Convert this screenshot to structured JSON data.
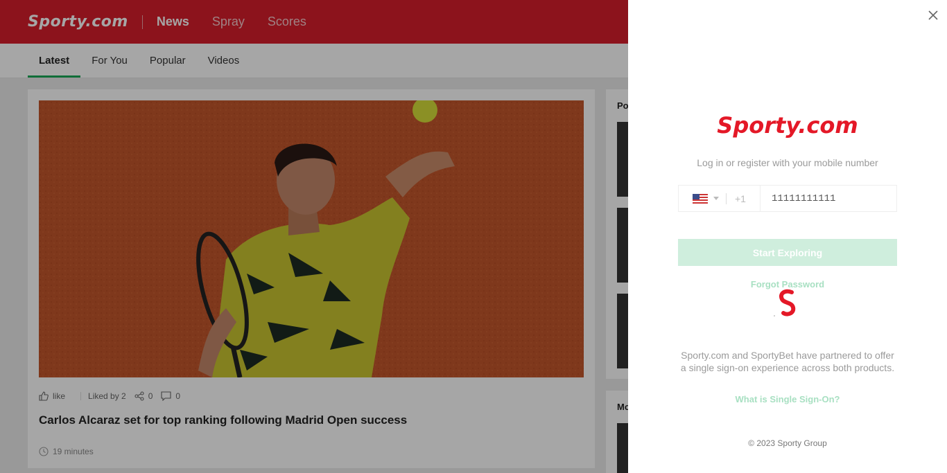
{
  "header": {
    "logo": "Sporty.com",
    "nav": [
      {
        "label": "News",
        "active": true
      },
      {
        "label": "Spray",
        "active": false
      },
      {
        "label": "Scores",
        "active": false
      }
    ]
  },
  "subtabs": [
    {
      "label": "Latest",
      "active": true
    },
    {
      "label": "For You",
      "active": false
    },
    {
      "label": "Popular",
      "active": false
    },
    {
      "label": "Videos",
      "active": false
    }
  ],
  "article": {
    "like_label": "like",
    "liked_by": "Liked by 2",
    "shares": "0",
    "comments": "0",
    "headline": "Carlos Alcaraz set for top ranking following Madrid Open success",
    "time": "19 minutes"
  },
  "sidebar": {
    "popular_title": "Po",
    "more_title": "Mo"
  },
  "login": {
    "logo": "Sporty.com",
    "subtitle": "Log in or register with your mobile number",
    "country_code": "+1",
    "phone_value": "11111111111",
    "start_button": "Start Exploring",
    "forgot_link": "Forgot Password",
    "sso_text": "Sporty.com and SportyBet have partnered to offer a single sign-on experience across both products.",
    "sso_link": "What is Single Sign-On?",
    "copyright": "© 2023 Sporty Group"
  },
  "colors": {
    "brand_red": "#d81e2c",
    "accent_green": "#1aa957",
    "disabled_green": "#cfeedd"
  }
}
